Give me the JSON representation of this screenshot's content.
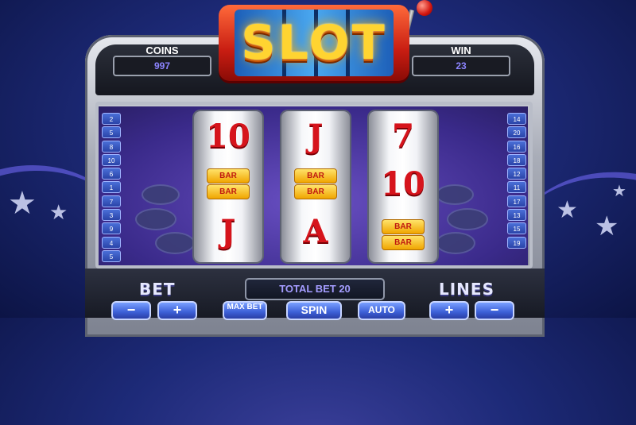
{
  "title": "SLOT",
  "counters": {
    "coins": {
      "label": "COINS",
      "value": "997"
    },
    "win": {
      "label": "WIN",
      "value": "23"
    }
  },
  "paylines_left": [
    "2",
    "5",
    "8",
    "10",
    "6",
    "1",
    "7",
    "3",
    "9",
    "4",
    "5"
  ],
  "paylines_right": [
    "14",
    "20",
    "16",
    "18",
    "12",
    "11",
    "17",
    "13",
    "15",
    "19"
  ],
  "reels": [
    {
      "top": "10",
      "middle": "BAR",
      "bottom": "J"
    },
    {
      "top": "J",
      "middle": "BAR",
      "bottom": "A"
    },
    {
      "top": "7",
      "middle": "10",
      "bottom": "BAR"
    }
  ],
  "controls": {
    "bet_label": "BET",
    "lines_label": "LINES",
    "total_bet": "TOTAL BET 20",
    "minus": "−",
    "plus": "+",
    "max_bet": "MAX BET",
    "spin": "SPIN",
    "auto": "AUTO"
  },
  "colors": {
    "accent": "#8c84ff",
    "reel_symbol": "#d6141c",
    "button": "#3c5fd6"
  }
}
